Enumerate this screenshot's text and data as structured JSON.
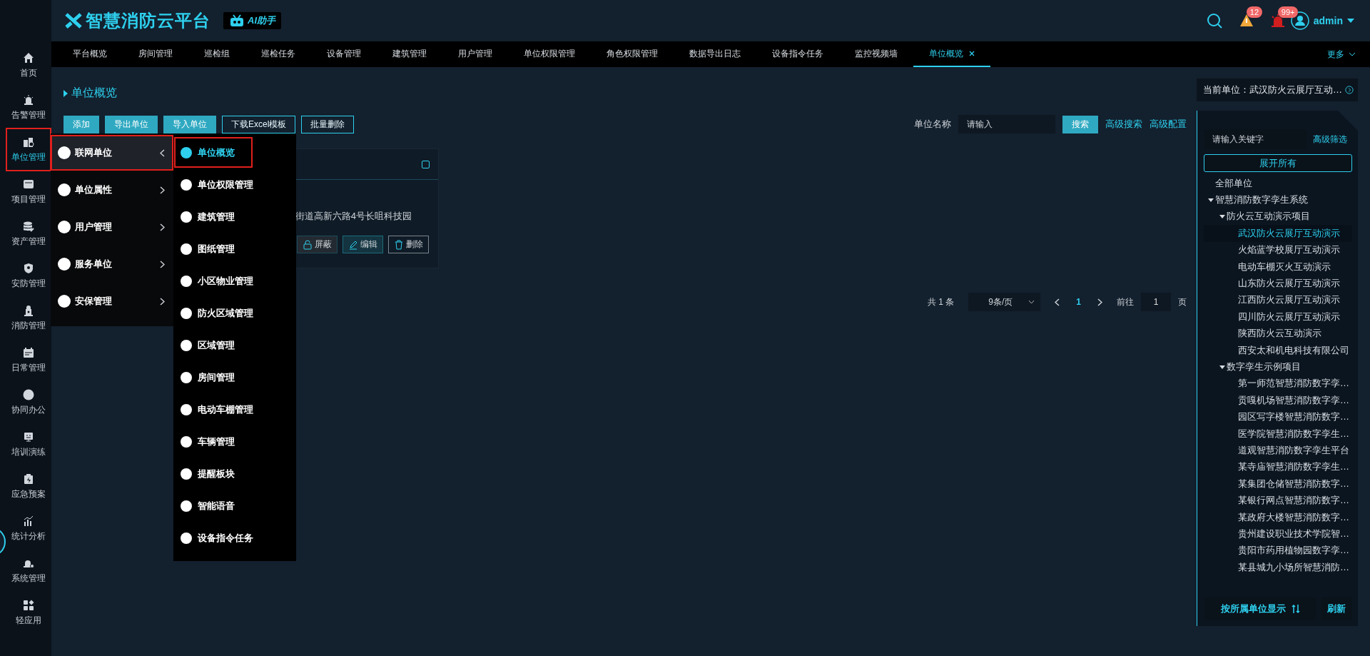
{
  "header": {
    "logo": "智慧消防云平台",
    "assistant": "AI助手",
    "alerts": [
      {
        "kind": "warning",
        "count": "12"
      },
      {
        "kind": "alarm",
        "count": "99+"
      }
    ],
    "user": "admin"
  },
  "sidebar": {
    "items": [
      {
        "label": "首页",
        "selected": false
      },
      {
        "label": "告警管理",
        "selected": false
      },
      {
        "label": "单位管理",
        "selected": true
      },
      {
        "label": "项目管理",
        "selected": false
      },
      {
        "label": "资产管理",
        "selected": false
      },
      {
        "label": "安防管理",
        "selected": false
      },
      {
        "label": "消防管理",
        "selected": false
      },
      {
        "label": "日常管理",
        "selected": false
      },
      {
        "label": "协同办公",
        "selected": false
      },
      {
        "label": "培训演练",
        "selected": false
      },
      {
        "label": "应急预案",
        "selected": false
      },
      {
        "label": "统计分析",
        "selected": false
      },
      {
        "label": "系统管理",
        "selected": false
      },
      {
        "label": "轻应用",
        "selected": false
      }
    ]
  },
  "tabs": {
    "items": [
      {
        "label": "平台概览",
        "selected": false,
        "closable": false
      },
      {
        "label": "房间管理",
        "selected": false,
        "closable": false
      },
      {
        "label": "巡检组",
        "selected": false,
        "closable": false
      },
      {
        "label": "巡检任务",
        "selected": false,
        "closable": false
      },
      {
        "label": "设备管理",
        "selected": false,
        "closable": false
      },
      {
        "label": "建筑管理",
        "selected": false,
        "closable": false
      },
      {
        "label": "用户管理",
        "selected": false,
        "closable": false
      },
      {
        "label": "单位权限管理",
        "selected": false,
        "closable": false
      },
      {
        "label": "角色权限管理",
        "selected": false,
        "closable": false
      },
      {
        "label": "数据导出日志",
        "selected": false,
        "closable": false
      },
      {
        "label": "设备指令任务",
        "selected": false,
        "closable": false
      },
      {
        "label": "监控视频墙",
        "selected": false,
        "closable": false
      },
      {
        "label": "单位概览",
        "selected": true,
        "closable": true
      }
    ],
    "more": "更多"
  },
  "page": {
    "title": "单位概览",
    "actions": [
      {
        "label": "添加",
        "kind": "filled"
      },
      {
        "label": "导出单位",
        "kind": "filled"
      },
      {
        "label": "导入单位",
        "kind": "filled"
      },
      {
        "label": "下载Excel模板",
        "kind": "outline"
      },
      {
        "label": "批量删除",
        "kind": "outline"
      }
    ],
    "search": {
      "label": "单位名称",
      "placeholder": "请输入",
      "button": "搜索",
      "links": [
        "高级搜索",
        "高级配置"
      ]
    }
  },
  "card": {
    "checked": false,
    "address": "街道高新六路4号长咀科技园",
    "buttons": [
      {
        "label": "屏蔽",
        "kind": "shield"
      },
      {
        "label": "编辑",
        "kind": "edit"
      },
      {
        "label": "删除",
        "kind": "delete"
      }
    ]
  },
  "pagination": {
    "total": "共 1 条",
    "page_size": "9条/页",
    "pages": [
      {
        "label": "1",
        "selected": true
      }
    ],
    "goto_label": "前往",
    "goto_value": "1",
    "goto_suffix": "页"
  },
  "current_unit": {
    "text": "当前单位：武汉防火云展厅互动…"
  },
  "tree": {
    "placeholder": "请输入关键字",
    "filter": "高级筛选",
    "expand_all": "展开所有",
    "nodes": [
      {
        "label": "全部单位",
        "expanded": false,
        "selected": false
      },
      {
        "label": "智慧消防数字孪生系统",
        "expanded": true,
        "selected": false,
        "children": [
          {
            "label": "防火云互动演示项目",
            "expanded": true,
            "selected": false,
            "children": [
              {
                "label": "武汉防火云展厅互动演示",
                "expanded": false,
                "selected": true
              },
              {
                "label": "火焰蓝学校展厅互动演示",
                "expanded": false,
                "selected": false
              },
              {
                "label": "电动车棚灭火互动演示",
                "expanded": false,
                "selected": false
              },
              {
                "label": "山东防火云展厅互动演示",
                "expanded": false,
                "selected": false
              },
              {
                "label": "江西防火云展厅互动演示",
                "expanded": false,
                "selected": false
              },
              {
                "label": "四川防火云展厅互动演示",
                "expanded": false,
                "selected": false
              },
              {
                "label": "陕西防火云互动演示",
                "expanded": false,
                "selected": false
              },
              {
                "label": "西安太和机电科技有限公司",
                "expanded": false,
                "selected": false
              }
            ]
          },
          {
            "label": "数字孪生示例项目",
            "expanded": true,
            "selected": false,
            "children": [
              {
                "label": "第一师范智慧消防数字孪…",
                "expanded": false,
                "selected": false
              },
              {
                "label": "贡嘎机场智慧消防数字孪…",
                "expanded": false,
                "selected": false
              },
              {
                "label": "园区写字楼智慧消防数字…",
                "expanded": false,
                "selected": false
              },
              {
                "label": "医学院智慧消防数字孪生…",
                "expanded": false,
                "selected": false
              },
              {
                "label": "道观智慧消防数字孪生平台",
                "expanded": false,
                "selected": false
              },
              {
                "label": "某寺庙智慧消防数字孪生…",
                "expanded": false,
                "selected": false
              },
              {
                "label": "某集团仓储智慧消防数字…",
                "expanded": false,
                "selected": false
              },
              {
                "label": "某银行网点智慧消防数字…",
                "expanded": false,
                "selected": false
              },
              {
                "label": "某政府大楼智慧消防数字…",
                "expanded": false,
                "selected": false
              },
              {
                "label": "贵州建设职业技术学院智…",
                "expanded": false,
                "selected": false
              },
              {
                "label": "贵阳市药用植物园数字孪…",
                "expanded": false,
                "selected": false
              },
              {
                "label": "某县城九小场所智慧消防…",
                "expanded": false,
                "selected": false
              }
            ]
          }
        ]
      }
    ],
    "sort_button": "按所属单位显示",
    "refresh": "刷新"
  },
  "menu": {
    "items": [
      {
        "label": "联网单位",
        "selected": true,
        "expanded": true
      },
      {
        "label": "单位属性",
        "selected": false,
        "expanded": false
      },
      {
        "label": "用户管理",
        "selected": false,
        "expanded": false
      },
      {
        "label": "服务单位",
        "selected": false,
        "expanded": false
      },
      {
        "label": "安保管理",
        "selected": false,
        "expanded": false
      }
    ]
  },
  "submenu": {
    "items": [
      {
        "label": "单位概览",
        "selected": true
      },
      {
        "label": "单位权限管理",
        "selected": false
      },
      {
        "label": "建筑管理",
        "selected": false
      },
      {
        "label": "图纸管理",
        "selected": false
      },
      {
        "label": "小区物业管理",
        "selected": false
      },
      {
        "label": "防火区域管理",
        "selected": false
      },
      {
        "label": "区域管理",
        "selected": false
      },
      {
        "label": "房间管理",
        "selected": false
      },
      {
        "label": "电动车棚管理",
        "selected": false
      },
      {
        "label": "车辆管理",
        "selected": false
      },
      {
        "label": "提醒板块",
        "selected": false
      },
      {
        "label": "智能语音",
        "selected": false
      },
      {
        "label": "设备指令任务",
        "selected": false
      }
    ]
  }
}
